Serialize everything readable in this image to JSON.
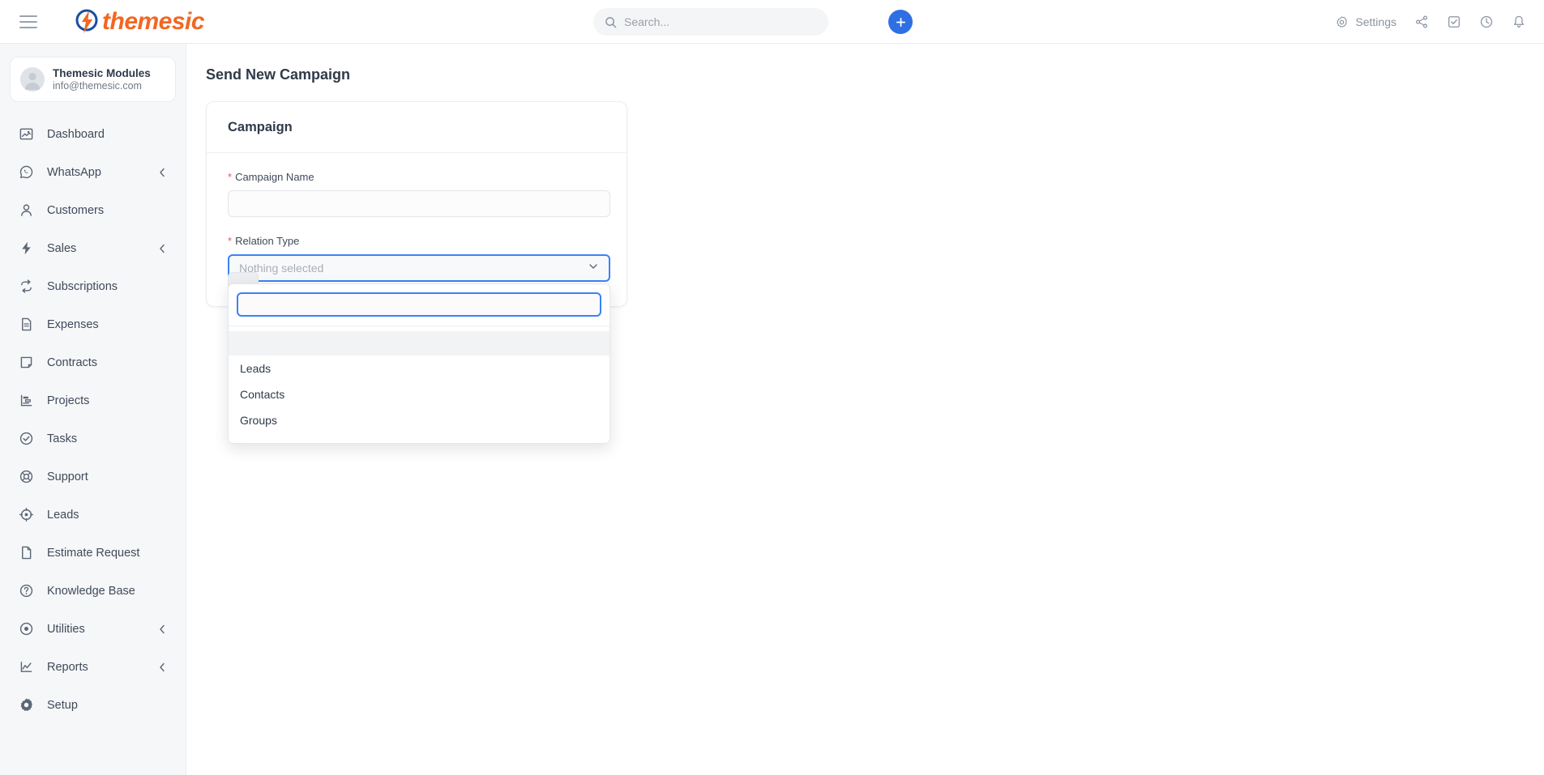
{
  "topbar": {
    "menu_icon": "hamburger-icon",
    "logo_text": "themesic",
    "logo_icon": "themesic-bolt-logo",
    "search": {
      "placeholder": "Search...",
      "value": "",
      "icon": "search-icon"
    },
    "add_button": {
      "label": "+",
      "icon": "plus-icon"
    },
    "settings": {
      "label": "Settings",
      "icon": "gear-icon"
    },
    "icons": [
      {
        "name": "share-icon"
      },
      {
        "name": "checkbox-icon"
      },
      {
        "name": "clock-icon"
      },
      {
        "name": "bell-icon"
      }
    ]
  },
  "sidebar": {
    "profile": {
      "name": "Themesic Modules",
      "email": "info@themesic.com",
      "avatar_icon": "avatar-icon"
    },
    "items": [
      {
        "label": "Dashboard",
        "icon": "dashboard-icon",
        "expandable": false
      },
      {
        "label": "WhatsApp",
        "icon": "whatsapp-icon",
        "expandable": true
      },
      {
        "label": "Customers",
        "icon": "user-icon",
        "expandable": false
      },
      {
        "label": "Sales",
        "icon": "bolt-icon",
        "expandable": true
      },
      {
        "label": "Subscriptions",
        "icon": "refresh-icon",
        "expandable": false
      },
      {
        "label": "Expenses",
        "icon": "document-icon",
        "expandable": false
      },
      {
        "label": "Contracts",
        "icon": "contract-icon",
        "expandable": false
      },
      {
        "label": "Projects",
        "icon": "projects-icon",
        "expandable": false
      },
      {
        "label": "Tasks",
        "icon": "check-circle-icon",
        "expandable": false
      },
      {
        "label": "Support",
        "icon": "lifebuoy-icon",
        "expandable": false
      },
      {
        "label": "Leads",
        "icon": "target-icon",
        "expandable": false
      },
      {
        "label": "Estimate Request",
        "icon": "file-icon",
        "expandable": false
      },
      {
        "label": "Knowledge Base",
        "icon": "question-circle-icon",
        "expandable": false
      },
      {
        "label": "Utilities",
        "icon": "record-circle-icon",
        "expandable": true
      },
      {
        "label": "Reports",
        "icon": "chart-line-icon",
        "expandable": true
      },
      {
        "label": "Setup",
        "icon": "cog-icon",
        "expandable": false
      }
    ]
  },
  "main": {
    "page_title": "Send New Campaign",
    "card": {
      "title": "Campaign",
      "fields": {
        "campaign_name": {
          "label": "Campaign Name",
          "required_marker": "*",
          "value": "",
          "placeholder": ""
        },
        "relation_type": {
          "label": "Relation Type",
          "required_marker": "*",
          "selected_text": "Nothing selected",
          "chevron_icon": "chevron-down-icon",
          "open": true,
          "search_value": "",
          "search_placeholder": "",
          "options": [
            "",
            "Leads",
            "Contacts",
            "Groups"
          ]
        }
      },
      "submit_button": {
        "label": ""
      }
    }
  },
  "colors": {
    "brand_orange": "#F26722",
    "logo_blue": "#1a4fa0",
    "accent_blue": "#2f6fe4",
    "focus_blue": "#3b82f6",
    "required_red": "#e25563",
    "sidebar_bg": "#f6f7f8",
    "text_dark": "#2f3a4a",
    "text_muted": "#8b93a0"
  }
}
